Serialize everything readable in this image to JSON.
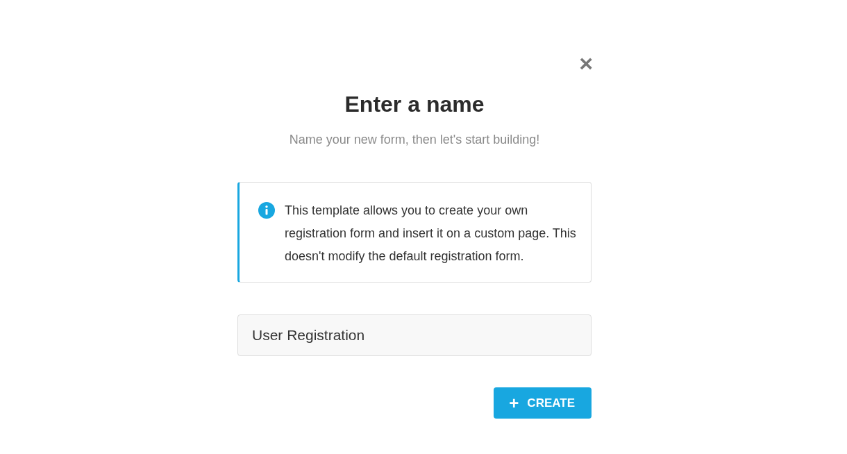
{
  "dialog": {
    "close": "×",
    "title": "Enter a name",
    "subtitle": "Name your new form, then let's start building!",
    "notice": {
      "kind": "info",
      "text": "This template allows you to create your own registration form and insert it on a custom page. This doesn't modify the default registration form."
    },
    "name_field": {
      "value": "User Registration"
    },
    "button": {
      "icon": "+",
      "label": "CREATE"
    }
  }
}
